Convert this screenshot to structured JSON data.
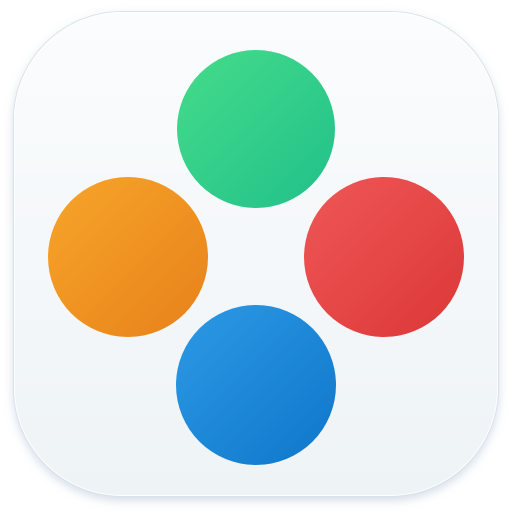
{
  "app_icon": {
    "tile_colors": {
      "background": "#f5f8fa",
      "border": "#d7e2ec"
    },
    "dots": [
      {
        "name": "green-dot",
        "color_light": "#45dc8a",
        "color_dark": "#20c08a"
      },
      {
        "name": "orange-dot",
        "color_light": "#f7a52a",
        "color_dark": "#e7811a"
      },
      {
        "name": "red-dot",
        "color_light": "#ef5757",
        "color_dark": "#dc3737"
      },
      {
        "name": "blue-dot",
        "color_light": "#2d9ae6",
        "color_dark": "#0f76c9"
      }
    ]
  }
}
